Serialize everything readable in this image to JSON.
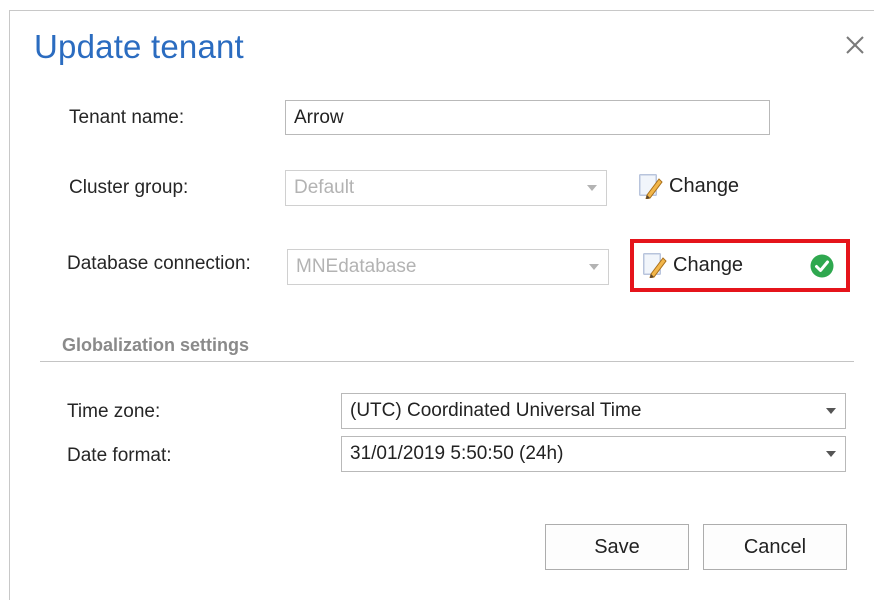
{
  "dialog": {
    "title": "Update tenant",
    "close_icon": "close-icon"
  },
  "form": {
    "tenant_name": {
      "label": "Tenant name:",
      "value": "Arrow"
    },
    "cluster_group": {
      "label": "Cluster group:",
      "value": "Default",
      "disabled": true,
      "change_label": "Change",
      "change_icon": "edit-pencil-icon"
    },
    "database_connection": {
      "label": "Database connection:",
      "value": "MNEdatabase",
      "disabled": true,
      "change_label": "Change",
      "change_icon": "edit-pencil-icon",
      "status_icon": "success-check-icon",
      "highlight_color": "#e5141b"
    }
  },
  "globalization": {
    "section_title": "Globalization settings",
    "time_zone": {
      "label": "Time zone:",
      "value": "(UTC) Coordinated Universal Time"
    },
    "date_format": {
      "label": "Date format:",
      "value": "31/01/2019 5:50:50 (24h)"
    }
  },
  "buttons": {
    "save_label": "Save",
    "cancel_label": "Cancel"
  },
  "colors": {
    "title": "#2b6cc0",
    "success": "#2fa84f",
    "highlight": "#e5141b"
  }
}
